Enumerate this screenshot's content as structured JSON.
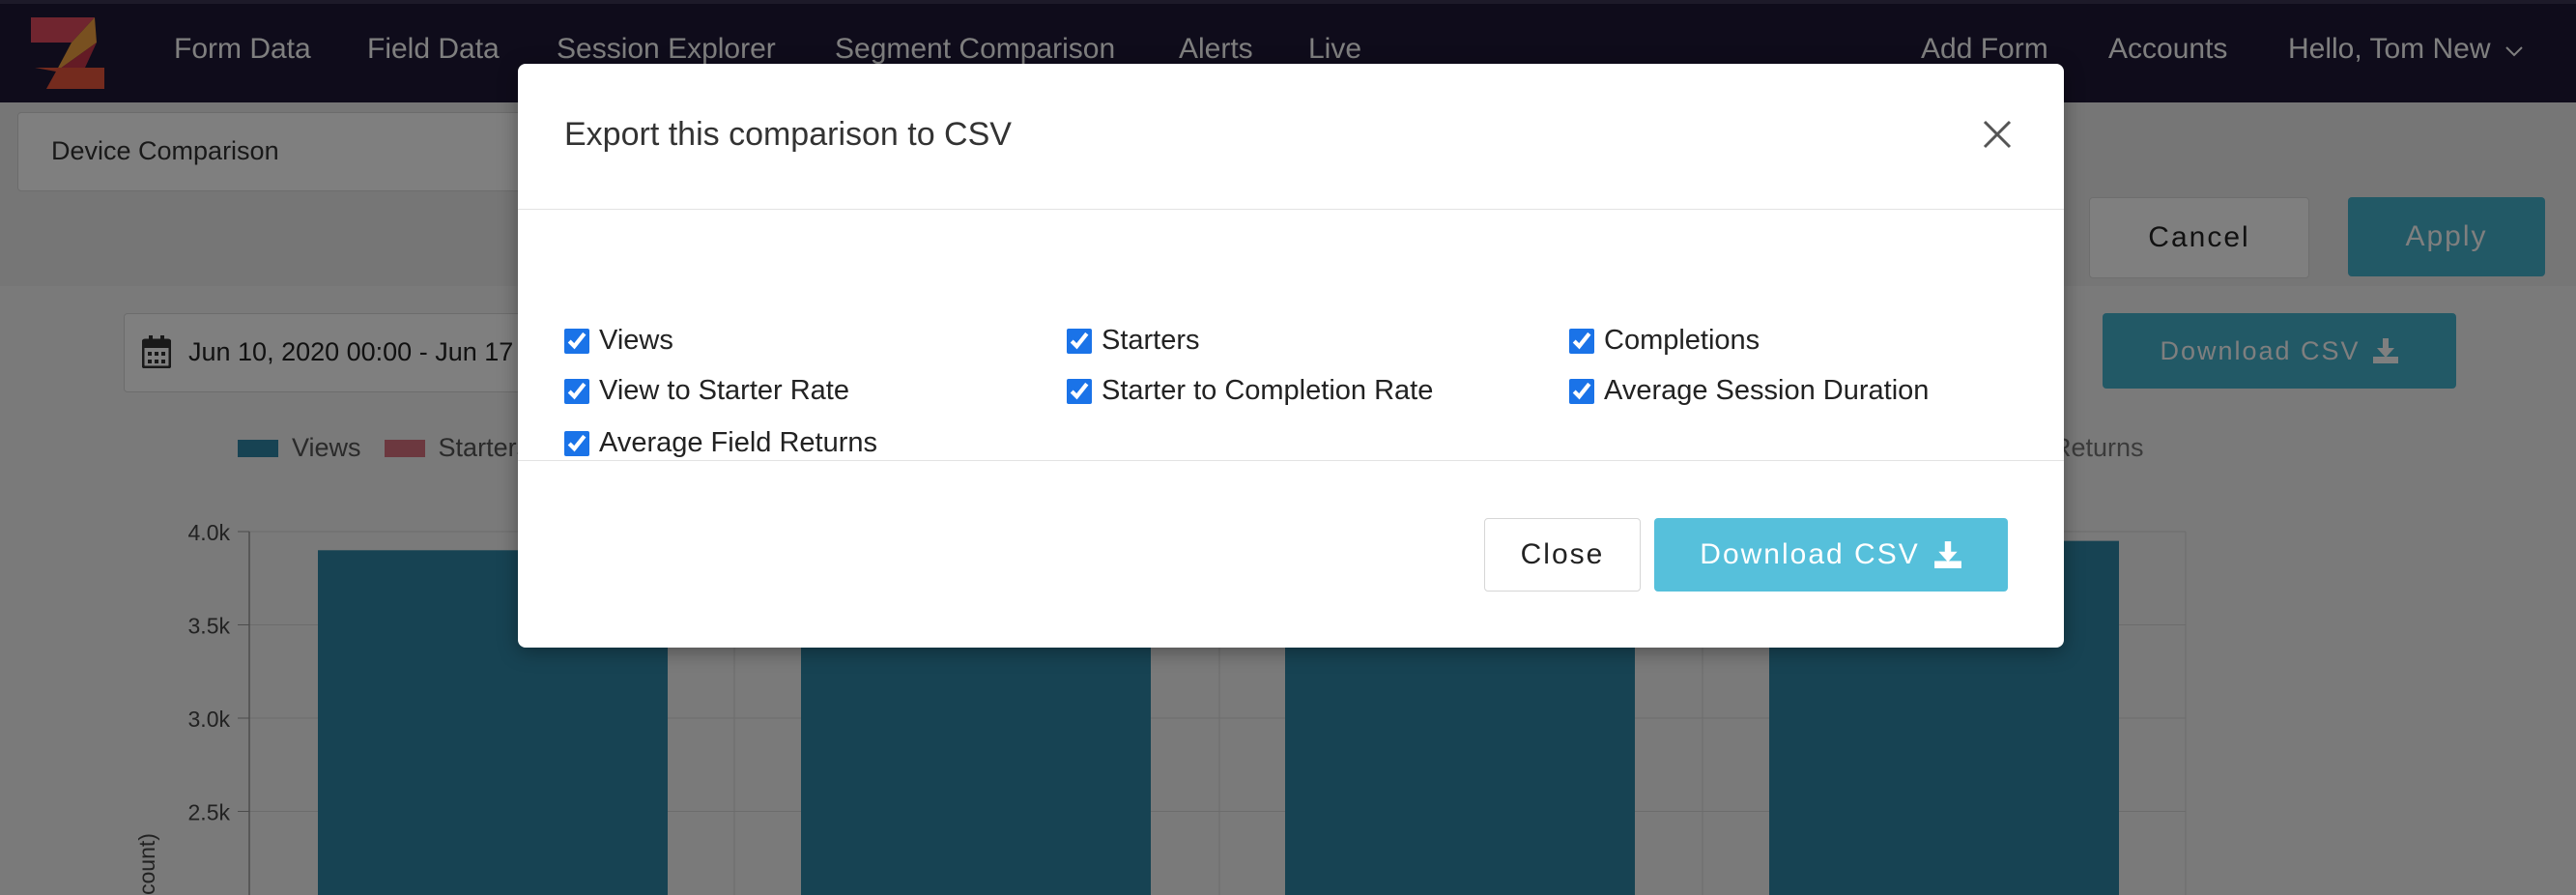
{
  "nav": {
    "links": [
      "Form Data",
      "Field Data",
      "Session Explorer",
      "Segment Comparison",
      "Alerts",
      "Live"
    ],
    "add_form": "Add Form",
    "accounts": "Accounts",
    "user": "Hello, Tom New"
  },
  "toolbar": {
    "segment": "Device Comparison",
    "cancel": "Cancel",
    "apply": "Apply",
    "date_range": "Jun 10, 2020 00:00 - Jun 17",
    "download": "Download CSV"
  },
  "legend": {
    "items": [
      {
        "label": "Views",
        "color": "#2e86a6"
      },
      {
        "label": "Starters",
        "color": "#d9707e"
      }
    ],
    "right_text": "Returns"
  },
  "chart_data": {
    "type": "bar",
    "series": [
      {
        "name": "Views",
        "values": [
          3900,
          3950,
          3900,
          3950
        ]
      }
    ],
    "y_ticks": [
      "4.0k",
      "3.5k",
      "3.0k",
      "2.5k"
    ],
    "ylabel": "count)",
    "ylim": [
      1900,
      4100
    ],
    "color": "#2e86a6"
  },
  "modal": {
    "title": "Export this comparison to CSV",
    "options": [
      {
        "label": "Views",
        "checked": true
      },
      {
        "label": "Starters",
        "checked": true
      },
      {
        "label": "Completions",
        "checked": true
      },
      {
        "label": "View to Starter Rate",
        "checked": true
      },
      {
        "label": "Starter to Completion Rate",
        "checked": true
      },
      {
        "label": "Average Session Duration",
        "checked": true
      },
      {
        "label": "Average Field Returns",
        "checked": true
      }
    ],
    "close_label": "Close",
    "download_label": "Download CSV"
  }
}
